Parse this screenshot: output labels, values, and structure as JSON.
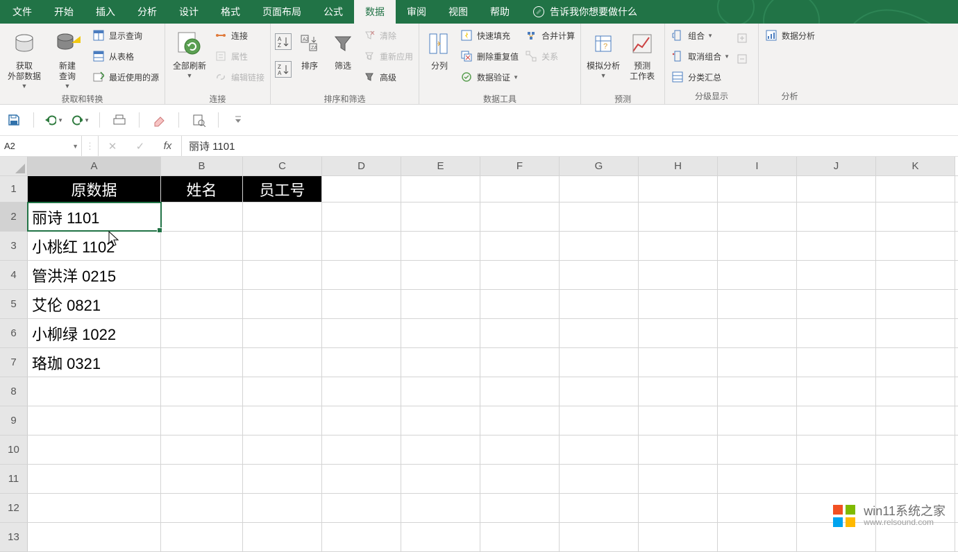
{
  "menus": [
    "文件",
    "开始",
    "插入",
    "分析",
    "设计",
    "格式",
    "页面布局",
    "公式",
    "数据",
    "审阅",
    "视图",
    "帮助"
  ],
  "active_menu_index": 8,
  "tell_me": "告诉我你想要做什么",
  "ribbon": {
    "get_transform": {
      "external_data": "获取\n外部数据",
      "new_query": "新建\n查询",
      "show_queries": "显示查询",
      "from_table": "从表格",
      "recent_sources": "最近使用的源",
      "group": "获取和转换"
    },
    "connections": {
      "refresh_all": "全部刷新",
      "connections": "连接",
      "properties": "属性",
      "edit_links": "编辑链接",
      "group": "连接"
    },
    "sort_filter": {
      "sort": "排序",
      "filter": "筛选",
      "clear": "清除",
      "reapply": "重新应用",
      "advanced": "高级",
      "group": "排序和筛选"
    },
    "data_tools": {
      "text_to_columns": "分列",
      "flash_fill": "快速填充",
      "remove_duplicates": "删除重复值",
      "data_validation": "数据验证",
      "consolidate": "合并计算",
      "relationships": "关系",
      "group": "数据工具"
    },
    "forecast": {
      "what_if": "模拟分析",
      "forecast_sheet": "预测\n工作表",
      "group": "预测"
    },
    "outline": {
      "group_btn": "组合",
      "ungroup": "取消组合",
      "subtotal": "分类汇总",
      "group": "分级显示"
    },
    "analysis": {
      "data_analysis": "数据分析",
      "group": "分析"
    }
  },
  "name_box": "A2",
  "formula_value": "丽诗 1101",
  "columns": [
    "A",
    "B",
    "C",
    "D",
    "E",
    "F",
    "G",
    "H",
    "I",
    "J",
    "K"
  ],
  "row_count": 13,
  "headers": {
    "A": "原数据",
    "B": "姓名",
    "C": "员工号"
  },
  "rows": [
    "丽诗 1101",
    "小桃红 1102",
    "管洪洋 0215",
    "艾伦 0821",
    "小柳绿 1022",
    "珞珈 0321"
  ],
  "watermark": {
    "line1": "win11系统之家",
    "line2": "www.relsound.com"
  }
}
